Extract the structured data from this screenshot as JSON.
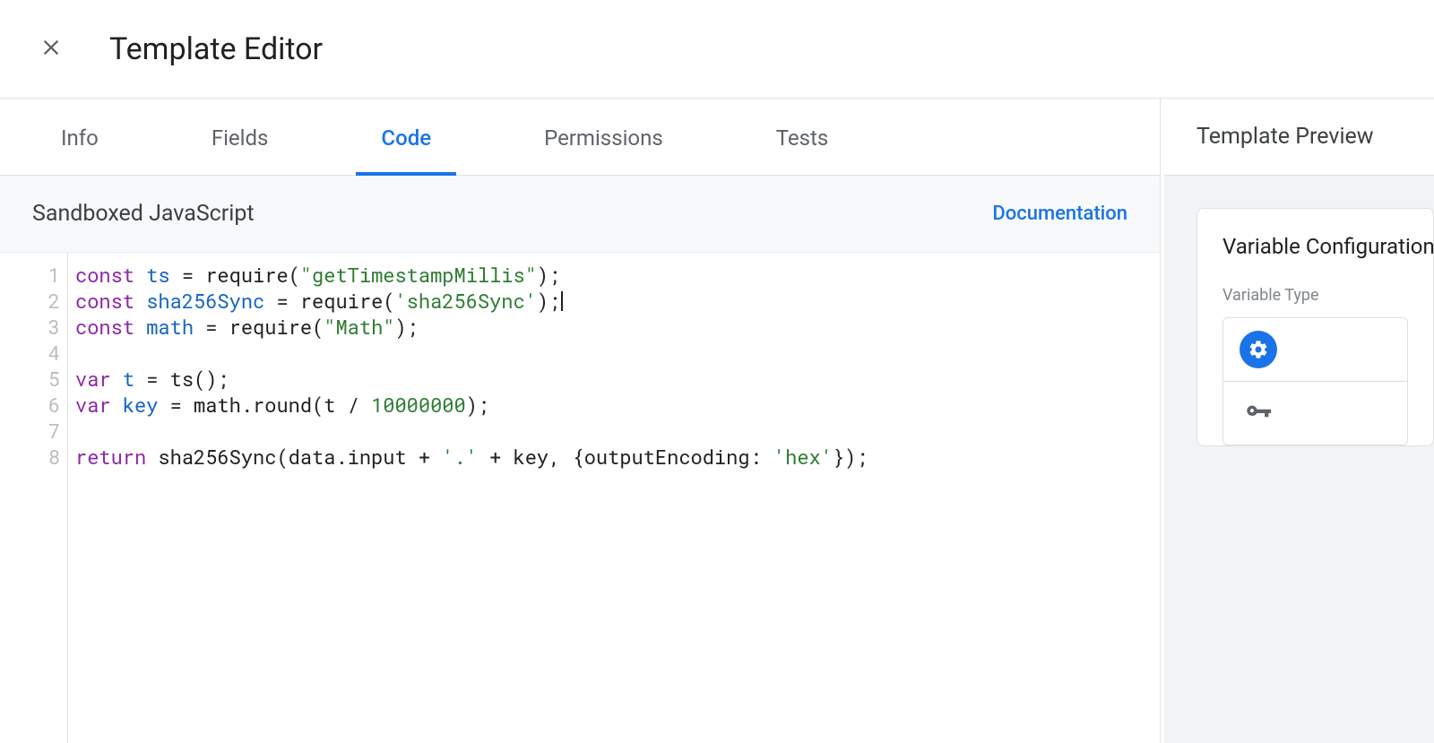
{
  "header": {
    "title": "Template Editor"
  },
  "tabs": [
    {
      "id": "info",
      "label": "Info",
      "active": false
    },
    {
      "id": "fields",
      "label": "Fields",
      "active": false
    },
    {
      "id": "code",
      "label": "Code",
      "active": true
    },
    {
      "id": "permissions",
      "label": "Permissions",
      "active": false
    },
    {
      "id": "tests",
      "label": "Tests",
      "active": false
    }
  ],
  "section": {
    "title": "Sandboxed JavaScript",
    "doc_link_label": "Documentation"
  },
  "code": {
    "line_numbers": [
      "1",
      "2",
      "3",
      "4",
      "5",
      "6",
      "7",
      "8"
    ],
    "lines": [
      [
        {
          "t": "kw",
          "v": "const"
        },
        {
          "t": "pl",
          "v": " "
        },
        {
          "t": "var",
          "v": "ts"
        },
        {
          "t": "pl",
          "v": " = require("
        },
        {
          "t": "str",
          "v": "\"getTimestampMillis\""
        },
        {
          "t": "pl",
          "v": ");"
        }
      ],
      [
        {
          "t": "kw",
          "v": "const"
        },
        {
          "t": "pl",
          "v": " "
        },
        {
          "t": "var",
          "v": "sha256Sync"
        },
        {
          "t": "pl",
          "v": " = require("
        },
        {
          "t": "str",
          "v": "'sha256Sync'"
        },
        {
          "t": "pl",
          "v": ");"
        },
        {
          "t": "caret",
          "v": ""
        }
      ],
      [
        {
          "t": "kw",
          "v": "const"
        },
        {
          "t": "pl",
          "v": " "
        },
        {
          "t": "var",
          "v": "math"
        },
        {
          "t": "pl",
          "v": " = require("
        },
        {
          "t": "str",
          "v": "\"Math\""
        },
        {
          "t": "pl",
          "v": ");"
        }
      ],
      [],
      [
        {
          "t": "kw",
          "v": "var"
        },
        {
          "t": "pl",
          "v": " "
        },
        {
          "t": "var",
          "v": "t"
        },
        {
          "t": "pl",
          "v": " = ts();"
        }
      ],
      [
        {
          "t": "kw",
          "v": "var"
        },
        {
          "t": "pl",
          "v": " "
        },
        {
          "t": "var",
          "v": "key"
        },
        {
          "t": "pl",
          "v": " = math.round(t / "
        },
        {
          "t": "num",
          "v": "10000000"
        },
        {
          "t": "pl",
          "v": ");"
        }
      ],
      [],
      [
        {
          "t": "kw",
          "v": "return"
        },
        {
          "t": "pl",
          "v": " sha256Sync(data.input + "
        },
        {
          "t": "str",
          "v": "'.'"
        },
        {
          "t": "pl",
          "v": " + key, {outputEncoding: "
        },
        {
          "t": "str",
          "v": "'hex'"
        },
        {
          "t": "pl",
          "v": "});"
        }
      ]
    ]
  },
  "side": {
    "header": "Template Preview",
    "card_title": "Variable Configuration",
    "field_label": "Variable Type",
    "rows": [
      {
        "icon": "gear-icon"
      },
      {
        "icon": "key-icon"
      }
    ]
  }
}
